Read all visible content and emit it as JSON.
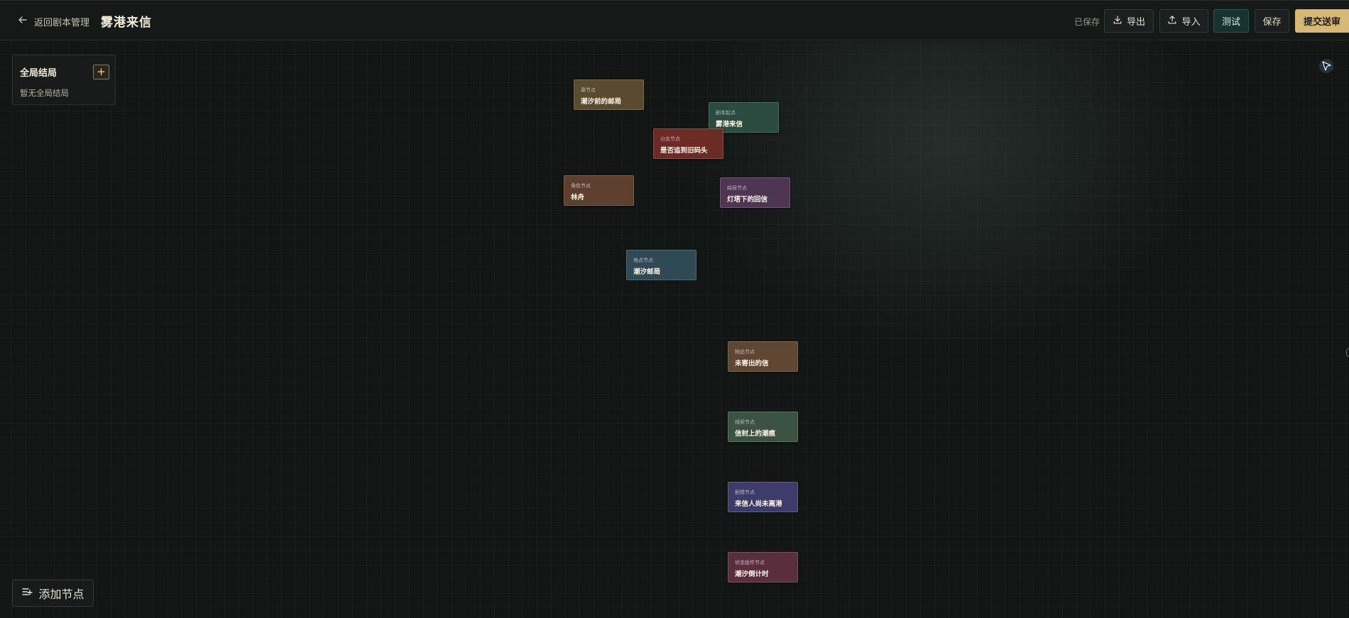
{
  "header": {
    "back_label": "返回剧本管理",
    "title": "雾港来信",
    "save_status": "已保存",
    "buttons": {
      "export": "导出",
      "import": "导入",
      "test": "测试",
      "save": "保存",
      "submit": "提交送审"
    }
  },
  "endings_panel": {
    "title": "全局结局",
    "add_label": "+",
    "empty_text": "暂无全局结局"
  },
  "nodes": [
    {
      "type": "幕节点",
      "name": "潮汐前的邮局",
      "color": "#5a4a2f"
    },
    {
      "type": "剧本起点",
      "name": "雾港来信",
      "color": "#2c4b40"
    },
    {
      "type": "分支节点",
      "name": "是否追到旧码头",
      "color": "#6d2b25"
    },
    {
      "type": "角色节点",
      "name": "林舟",
      "color": "#5e3e2d"
    },
    {
      "type": "结局节点",
      "name": "灯塔下的回信",
      "color": "#4e3552"
    },
    {
      "type": "地点节点",
      "name": "潮汐邮局",
      "color": "#2f4a55"
    },
    {
      "type": "物品节点",
      "name": "未寄出的信",
      "color": "#5e4630"
    },
    {
      "type": "线索节点",
      "name": "信封上的潮痕",
      "color": "#3c5344"
    },
    {
      "type": "剧情节点",
      "name": "来信人尚未离港",
      "color": "#3d3b6a"
    },
    {
      "type": "状态组件节点",
      "name": "潮汐倒计时",
      "color": "#5a2f3d"
    }
  ],
  "toolbar": {
    "add_node_label": "添加节点"
  },
  "icons": {
    "back": "arrow-left-icon",
    "export": "download-icon",
    "import": "upload-icon",
    "add_node": "list-add-icon",
    "pointer": "cursor-pointer-icon"
  },
  "colors": {
    "accent": "#d6b874",
    "test_button": "#173230",
    "background": "#121615"
  }
}
